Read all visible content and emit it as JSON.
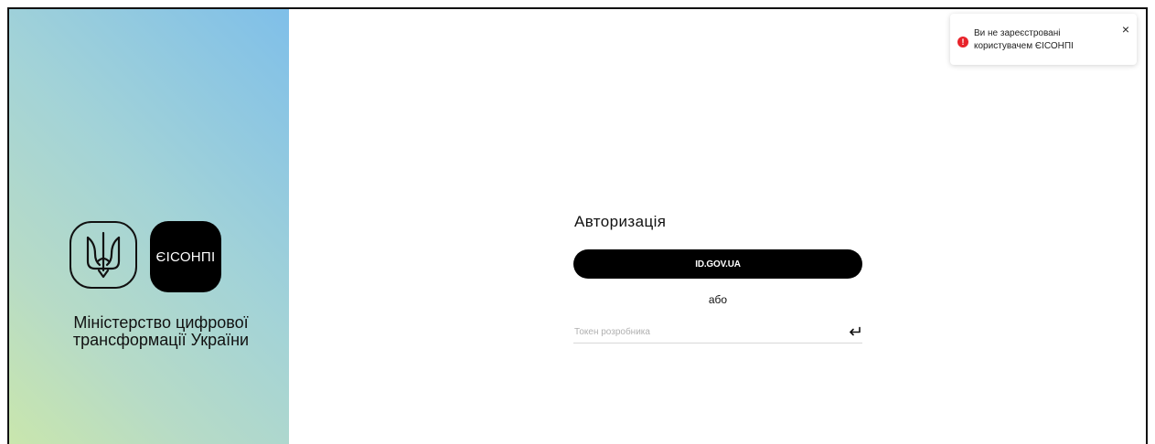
{
  "sidebar": {
    "brand_label": "ЄІСОНПІ",
    "ministry_text": "Міністерство цифрової трансформації України"
  },
  "auth": {
    "title": "Авторизація",
    "idgov_button_label": "ID.GOV.UA",
    "or_label": "або",
    "token_placeholder": "Токен розробника",
    "token_value": ""
  },
  "toast": {
    "message": "Ви не зареєстровані користувачем ЄІСОНПІ",
    "icon_glyph": "!",
    "close_glyph": "×",
    "status_color": "#e8232a"
  },
  "icons": {
    "emblem": "tryzub-icon",
    "submit": "enter-arrow-icon",
    "error": "error-icon",
    "close": "close-icon"
  }
}
